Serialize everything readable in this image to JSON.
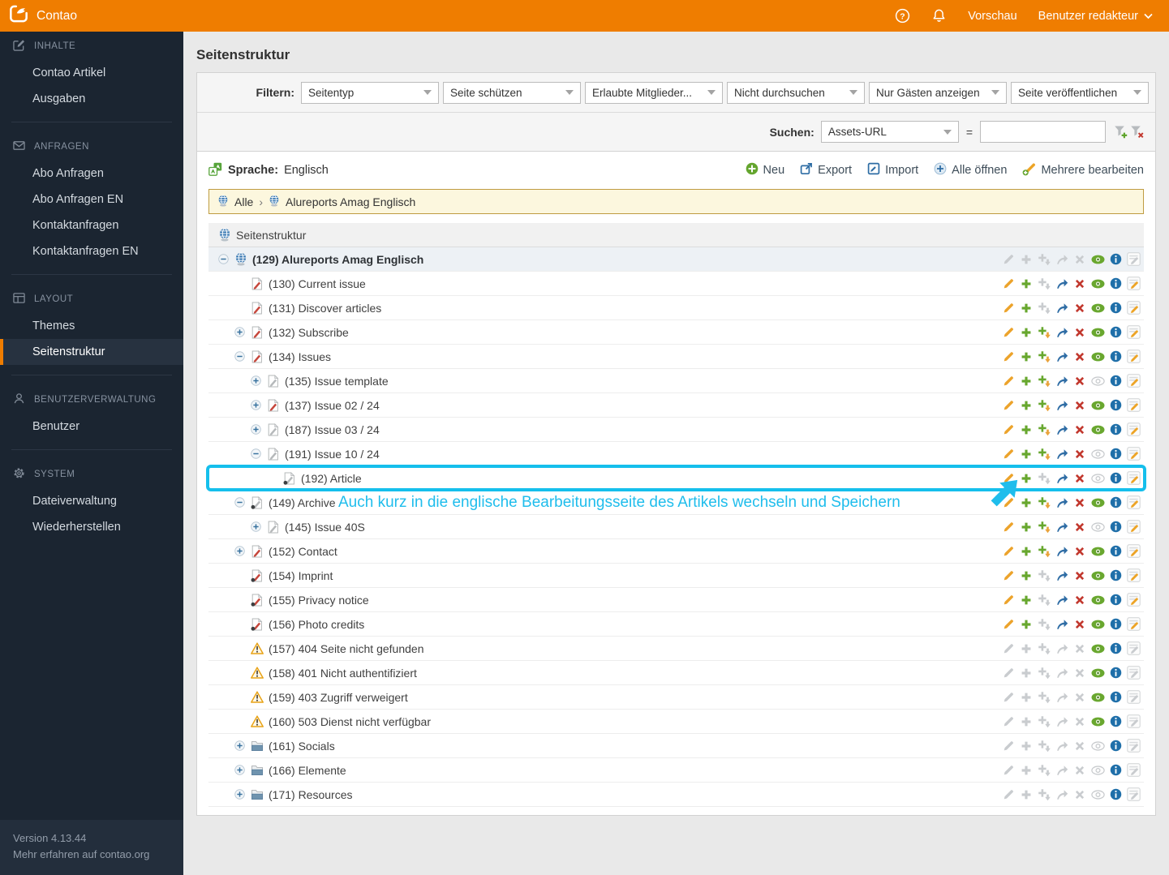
{
  "header": {
    "brand": "Contao",
    "preview_label": "Vorschau",
    "user_label": "Benutzer redakteur"
  },
  "sidebar": {
    "sections": [
      {
        "label": "INHALTE",
        "icon": "edit-icon",
        "items": [
          {
            "label": "Contao Artikel",
            "active": false
          },
          {
            "label": "Ausgaben",
            "active": false
          }
        ]
      },
      {
        "label": "ANFRAGEN",
        "icon": "inbox-icon",
        "items": [
          {
            "label": "Abo Anfragen",
            "active": false
          },
          {
            "label": "Abo Anfragen EN",
            "active": false
          },
          {
            "label": "Kontaktanfragen",
            "active": false
          },
          {
            "label": "Kontaktanfragen EN",
            "active": false
          }
        ]
      },
      {
        "label": "LAYOUT",
        "icon": "layout-icon",
        "items": [
          {
            "label": "Themes",
            "active": false
          },
          {
            "label": "Seitenstruktur",
            "active": true
          }
        ]
      },
      {
        "label": "BENUTZERVERWALTUNG",
        "icon": "user-icon",
        "items": [
          {
            "label": "Benutzer",
            "active": false
          }
        ]
      },
      {
        "label": "SYSTEM",
        "icon": "gear-icon",
        "items": [
          {
            "label": "Dateiverwaltung",
            "active": false
          },
          {
            "label": "Wiederherstellen",
            "active": false
          }
        ]
      }
    ],
    "footer": {
      "version": "Version 4.13.44",
      "more": "Mehr erfahren auf contao.org"
    }
  },
  "main": {
    "title": "Seitenstruktur",
    "filter": {
      "label": "Filtern:",
      "selects": [
        "Seitentyp",
        "Seite schützen",
        "Erlaubte Mitglieder...",
        "Nicht durchsuchen",
        "Nur Gästen anzeigen",
        "Seite veröffentlichen"
      ]
    },
    "search": {
      "label": "Suchen:",
      "key": "Assets-URL",
      "operator": "=",
      "value": ""
    },
    "language": {
      "label": "Sprache:",
      "value": "Englisch"
    },
    "toolbar": [
      {
        "icon": "new-icon",
        "label": "Neu"
      },
      {
        "icon": "export-icon",
        "label": "Export"
      },
      {
        "icon": "import-icon",
        "label": "Import"
      },
      {
        "icon": "expand-all-icon",
        "label": "Alle öffnen"
      },
      {
        "icon": "edit-multiple-icon",
        "label": "Mehrere bearbeiten"
      }
    ],
    "breadcrumb": {
      "root": "Alle",
      "separator": "›",
      "current": "Alureports Amag Englisch"
    },
    "tree": {
      "header": "Seitenstruktur",
      "rows": [
        {
          "label": "(129) Alureports Amag Englisch",
          "level": 0,
          "toggle": "minus",
          "icon": "site-root-icon",
          "bold": true,
          "actions": {
            "edit": "off",
            "new": "off",
            "paste": "off",
            "move": "off",
            "del": "off",
            "eye": "on",
            "info": "on",
            "articles": "off"
          }
        },
        {
          "label": "(130) Current issue",
          "level": 1,
          "toggle": "",
          "icon": "page-icon",
          "actions": {
            "edit": "on",
            "new": "on",
            "paste": "off",
            "move": "on",
            "del": "on",
            "eye": "on",
            "info": "on",
            "articles": "on"
          }
        },
        {
          "label": "(131) Discover articles",
          "level": 1,
          "toggle": "",
          "icon": "page-icon",
          "actions": {
            "edit": "on",
            "new": "on",
            "paste": "off",
            "move": "on",
            "del": "on",
            "eye": "on",
            "info": "on",
            "articles": "on"
          }
        },
        {
          "label": "(132) Subscribe",
          "level": 1,
          "toggle": "plus",
          "icon": "page-icon",
          "actions": {
            "edit": "on",
            "new": "on",
            "paste": "on",
            "move": "on",
            "del": "on",
            "eye": "on",
            "info": "on",
            "articles": "on"
          }
        },
        {
          "label": "(134) Issues",
          "level": 1,
          "toggle": "minus",
          "icon": "page-icon",
          "actions": {
            "edit": "on",
            "new": "on",
            "paste": "on",
            "move": "on",
            "del": "on",
            "eye": "on",
            "info": "on",
            "articles": "on"
          }
        },
        {
          "label": "(135) Issue template",
          "level": 2,
          "toggle": "plus",
          "icon": "page-unpublished-icon",
          "actions": {
            "edit": "on",
            "new": "on",
            "paste": "on",
            "move": "on",
            "del": "on",
            "eye": "off",
            "info": "on",
            "articles": "on"
          }
        },
        {
          "label": "(137) Issue 02 / 24",
          "level": 2,
          "toggle": "plus",
          "icon": "page-icon",
          "actions": {
            "edit": "on",
            "new": "on",
            "paste": "on",
            "move": "on",
            "del": "on",
            "eye": "on",
            "info": "on",
            "articles": "on"
          }
        },
        {
          "label": "(187) Issue 03 / 24",
          "level": 2,
          "toggle": "plus",
          "icon": "page-unpublished-icon",
          "actions": {
            "edit": "on",
            "new": "on",
            "paste": "on",
            "move": "on",
            "del": "on",
            "eye": "on",
            "info": "on",
            "articles": "on"
          }
        },
        {
          "label": "(191) Issue 10 / 24",
          "level": 2,
          "toggle": "minus",
          "icon": "page-unpublished-icon",
          "actions": {
            "edit": "on",
            "new": "on",
            "paste": "on",
            "move": "on",
            "del": "on",
            "eye": "off",
            "info": "on",
            "articles": "on"
          }
        },
        {
          "label": "(192) Article",
          "level": 3,
          "toggle": "",
          "icon": "page-unpublished-hidden-icon",
          "highlight": true,
          "actions": {
            "edit": "on",
            "new": "on",
            "paste": "off",
            "move": "on",
            "del": "on",
            "eye": "off",
            "info": "on",
            "articles": "on"
          }
        },
        {
          "label": "(149) Archive",
          "level": 1,
          "toggle": "minus",
          "icon": "page-unpublished-hidden-icon",
          "actions": {
            "edit": "on",
            "new": "on",
            "paste": "on",
            "move": "on",
            "del": "on",
            "eye": "on",
            "info": "on",
            "articles": "on"
          }
        },
        {
          "label": "(145) Issue 40S",
          "level": 2,
          "toggle": "plus",
          "icon": "page-unpublished-icon",
          "actions": {
            "edit": "on",
            "new": "on",
            "paste": "on",
            "move": "on",
            "del": "on",
            "eye": "off",
            "info": "on",
            "articles": "on"
          }
        },
        {
          "label": "(152) Contact",
          "level": 1,
          "toggle": "plus",
          "icon": "page-icon",
          "actions": {
            "edit": "on",
            "new": "on",
            "paste": "on",
            "move": "on",
            "del": "on",
            "eye": "on",
            "info": "on",
            "articles": "on"
          }
        },
        {
          "label": "(154) Imprint",
          "level": 1,
          "toggle": "",
          "icon": "page-hidden-icon",
          "actions": {
            "edit": "on",
            "new": "on",
            "paste": "off",
            "move": "on",
            "del": "on",
            "eye": "on",
            "info": "on",
            "articles": "on"
          }
        },
        {
          "label": "(155) Privacy notice",
          "level": 1,
          "toggle": "",
          "icon": "page-hidden-icon",
          "actions": {
            "edit": "on",
            "new": "on",
            "paste": "off",
            "move": "on",
            "del": "on",
            "eye": "on",
            "info": "on",
            "articles": "on"
          }
        },
        {
          "label": "(156) Photo credits",
          "level": 1,
          "toggle": "",
          "icon": "page-hidden-icon",
          "actions": {
            "edit": "on",
            "new": "on",
            "paste": "off",
            "move": "on",
            "del": "on",
            "eye": "on",
            "info": "on",
            "articles": "on"
          }
        },
        {
          "label": "(157) 404 Seite nicht gefunden",
          "level": 1,
          "toggle": "",
          "icon": "error-page-icon",
          "actions": {
            "edit": "off",
            "new": "off",
            "paste": "off",
            "move": "off",
            "del": "off",
            "eye": "on",
            "info": "on",
            "articles": "off"
          }
        },
        {
          "label": "(158) 401 Nicht authentifiziert",
          "level": 1,
          "toggle": "",
          "icon": "error-page-icon",
          "actions": {
            "edit": "off",
            "new": "off",
            "paste": "off",
            "move": "off",
            "del": "off",
            "eye": "on",
            "info": "on",
            "articles": "off"
          }
        },
        {
          "label": "(159) 403 Zugriff verweigert",
          "level": 1,
          "toggle": "",
          "icon": "error-page-icon",
          "actions": {
            "edit": "off",
            "new": "off",
            "paste": "off",
            "move": "off",
            "del": "off",
            "eye": "on",
            "info": "on",
            "articles": "off"
          }
        },
        {
          "label": "(160) 503 Dienst nicht verfügbar",
          "level": 1,
          "toggle": "",
          "icon": "error-page-icon",
          "actions": {
            "edit": "off",
            "new": "off",
            "paste": "off",
            "move": "off",
            "del": "off",
            "eye": "on",
            "info": "on",
            "articles": "off"
          }
        },
        {
          "label": "(161) Socials",
          "level": 1,
          "toggle": "plus",
          "icon": "folder-page-icon",
          "actions": {
            "edit": "off",
            "new": "off",
            "paste": "off",
            "move": "off",
            "del": "off",
            "eye": "off",
            "info": "on",
            "articles": "off"
          }
        },
        {
          "label": "(166) Elemente",
          "level": 1,
          "toggle": "plus",
          "icon": "folder-page-icon",
          "actions": {
            "edit": "off",
            "new": "off",
            "paste": "off",
            "move": "off",
            "del": "off",
            "eye": "off",
            "info": "on",
            "articles": "off"
          }
        },
        {
          "label": "(171) Resources",
          "level": 1,
          "toggle": "plus",
          "icon": "folder-page-icon",
          "actions": {
            "edit": "off",
            "new": "off",
            "paste": "off",
            "move": "off",
            "del": "off",
            "eye": "off",
            "info": "on",
            "articles": "off"
          }
        }
      ]
    },
    "annotation": {
      "text": "Auch kurz in die englische Bearbeitungsseite des Artikels wechseln und Speichern",
      "color": "#1fbdec"
    }
  },
  "colors": {
    "accent": "#ef7d00",
    "highlight": "#15bfec",
    "annotation": "#1fbdec"
  }
}
